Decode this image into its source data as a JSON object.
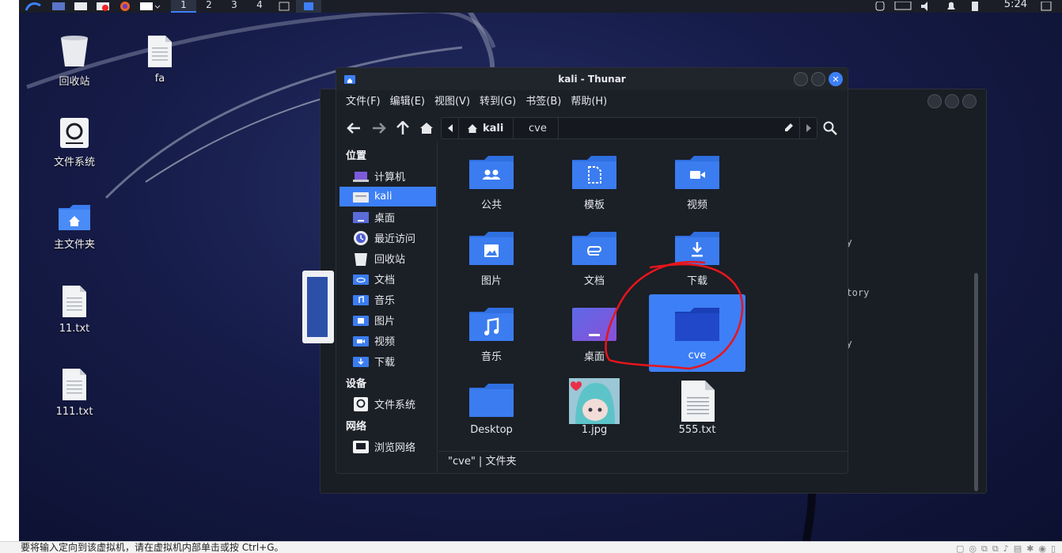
{
  "top_panel": {
    "workspaces": [
      "1",
      "2",
      "3",
      "4"
    ],
    "active_workspace": "1",
    "clock": "5:24"
  },
  "desktop_icons": [
    {
      "label": "回收站",
      "icon": "trash-icon"
    },
    {
      "label": "fa",
      "icon": "text-file-icon"
    },
    {
      "label": "文件系统",
      "icon": "drive-icon"
    },
    {
      "label": "主文件夹",
      "icon": "home-folder-icon"
    },
    {
      "label": "11.txt",
      "icon": "text-file-icon"
    },
    {
      "label": "111.txt",
      "icon": "text-file-icon"
    }
  ],
  "terminal": {
    "visible_fragments": [
      "ory",
      "ectory",
      "ory"
    ]
  },
  "thunar": {
    "title": "kali - Thunar",
    "menu": [
      "文件(F)",
      "编辑(E)",
      "视图(V)",
      "转到(G)",
      "书签(B)",
      "帮助(H)"
    ],
    "path": {
      "home": "kali",
      "current": "cve"
    },
    "sidebar": {
      "places_heading": "位置",
      "places": [
        {
          "label": "计算机",
          "icon": "computer-icon"
        },
        {
          "label": "kali",
          "icon": "home-icon",
          "selected": true
        },
        {
          "label": "桌面",
          "icon": "desktop-icon"
        },
        {
          "label": "最近访问",
          "icon": "recent-icon"
        },
        {
          "label": "回收站",
          "icon": "trash-icon"
        },
        {
          "label": "文档",
          "icon": "documents-folder-icon"
        },
        {
          "label": "音乐",
          "icon": "music-folder-icon"
        },
        {
          "label": "图片",
          "icon": "pictures-folder-icon"
        },
        {
          "label": "视频",
          "icon": "videos-folder-icon"
        },
        {
          "label": "下载",
          "icon": "downloads-folder-icon"
        }
      ],
      "devices_heading": "设备",
      "devices": [
        {
          "label": "文件系统",
          "icon": "drive-icon"
        }
      ],
      "network_heading": "网络",
      "network": [
        {
          "label": "浏览网络",
          "icon": "network-icon"
        }
      ]
    },
    "files": [
      {
        "label": "公共",
        "icon": "public-folder-icon"
      },
      {
        "label": "模板",
        "icon": "templates-folder-icon"
      },
      {
        "label": "视频",
        "icon": "videos-folder-icon"
      },
      {
        "label": "图片",
        "icon": "pictures-folder-icon"
      },
      {
        "label": "文档",
        "icon": "documents-folder-icon"
      },
      {
        "label": "下载",
        "icon": "downloads-folder-icon"
      },
      {
        "label": "音乐",
        "icon": "music-folder-icon"
      },
      {
        "label": "桌面",
        "icon": "desktop-folder-icon"
      },
      {
        "label": "cve",
        "icon": "folder-icon",
        "selected": true
      },
      {
        "label": "Desktop",
        "icon": "folder-icon"
      },
      {
        "label": "1.jpg",
        "icon": "image-thumbnail"
      },
      {
        "label": "555.txt",
        "icon": "text-file-icon"
      }
    ],
    "status": "\"cve\" | 文件夹"
  },
  "vm_status_bar": "要将输入定向到该虚拟机，请在虚拟机内部单击或按 Ctrl+G。",
  "colors": {
    "accent": "#3d7ff6",
    "folder": "#3b7cf0",
    "window_bg": "#1b1f26",
    "annotation": "#e8151c"
  }
}
